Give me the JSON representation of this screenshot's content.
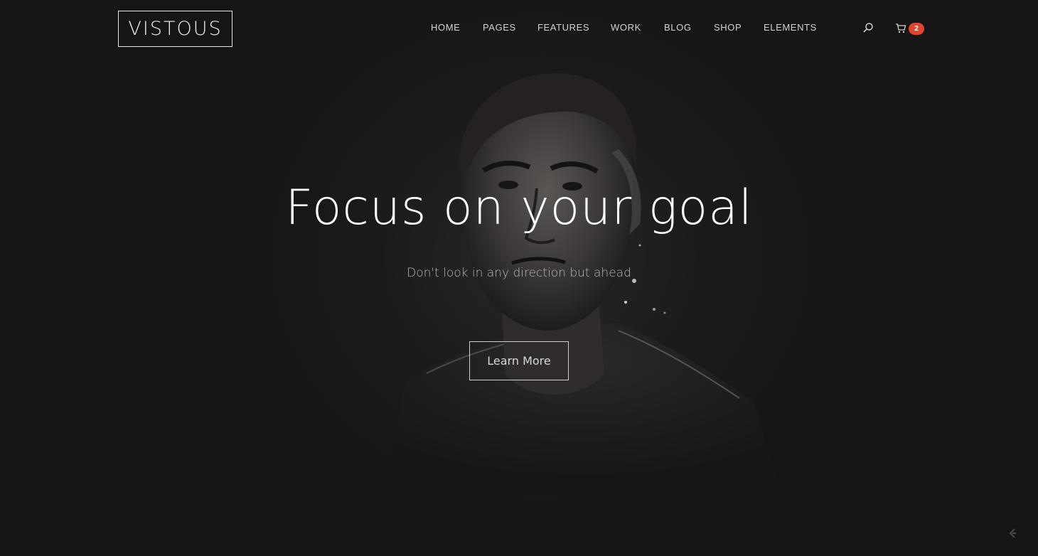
{
  "brand": {
    "logo_text": "VISTOUS"
  },
  "nav": {
    "items": [
      {
        "label": "HOME"
      },
      {
        "label": "PAGES"
      },
      {
        "label": "FEATURES"
      },
      {
        "label": "WORK"
      },
      {
        "label": "BLOG"
      },
      {
        "label": "SHOP"
      },
      {
        "label": "ELEMENTS"
      }
    ]
  },
  "header": {
    "search_icon": "search-icon",
    "cart_icon": "cart-icon",
    "cart_count": "2",
    "badge_color": "#e0462f"
  },
  "hero": {
    "headline": "Focus on your goal",
    "subline": "Don't look in any direction but ahead",
    "cta_label": "Learn More",
    "background_color": "#161414"
  },
  "footer": {
    "corner_icon": "builder-icon"
  }
}
